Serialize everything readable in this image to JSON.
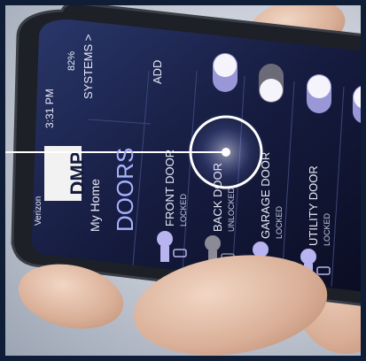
{
  "status_bar": {
    "carrier": "Verizon",
    "time": "3:31 PM",
    "battery": "82%"
  },
  "header": {
    "brand": "DMP",
    "systems_link": "SYSTEMS >",
    "home_label": "My Home",
    "section_title": "DOORS",
    "add_label": "ADD"
  },
  "doors": [
    {
      "name": "FRONT DOOR",
      "status": "LOCKED",
      "toggle_on": true
    },
    {
      "name": "BACK DOOR",
      "status": "UNLOCKED",
      "toggle_on": false
    },
    {
      "name": "GARAGE DOOR",
      "status": "LOCKED",
      "toggle_on": true
    },
    {
      "name": "UTILITY DOOR",
      "status": "LOCKED",
      "toggle_on": true
    }
  ],
  "colors": {
    "frame_navy": "#0f1d36",
    "screen_bg": "#141b3d",
    "accent_lavender": "#b8b4f0",
    "highlight_red": "#d23a3a"
  }
}
